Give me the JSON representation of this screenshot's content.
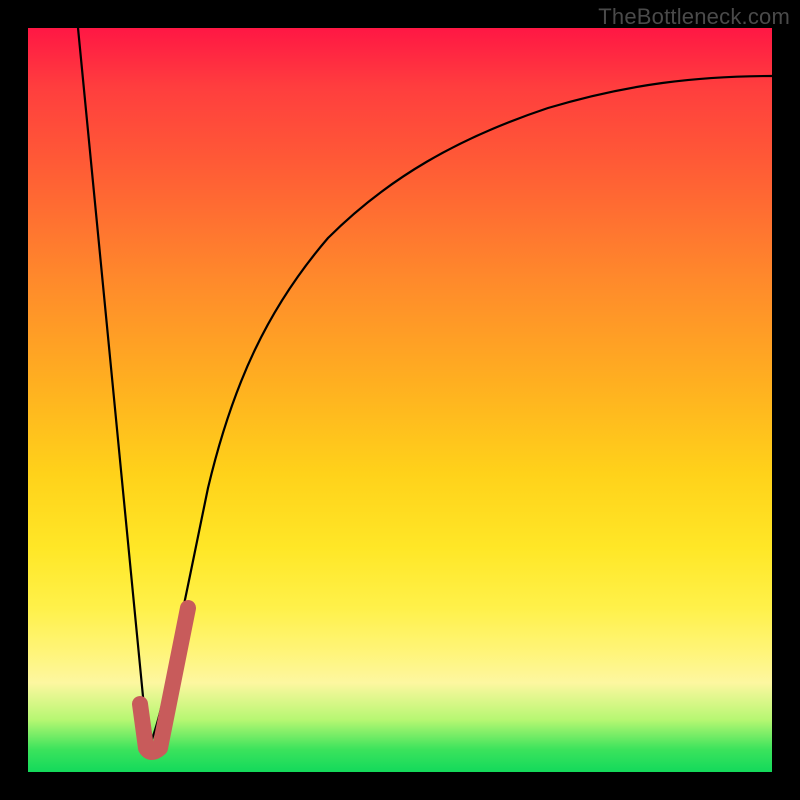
{
  "watermark": "TheBottleneck.com",
  "colors": {
    "frame": "#000000",
    "curve": "#000000",
    "accent_marker": "#c85b5b"
  },
  "chart_data": {
    "type": "line",
    "title": "",
    "xlabel": "",
    "ylabel": "",
    "xlim": [
      0,
      100
    ],
    "ylim": [
      0,
      100
    ],
    "grid": false,
    "series": [
      {
        "name": "left-slope",
        "x": [
          5,
          16
        ],
        "y": [
          100,
          3
        ]
      },
      {
        "name": "right-curve",
        "x": [
          16,
          20,
          25,
          30,
          35,
          40,
          45,
          50,
          55,
          60,
          70,
          80,
          90,
          100
        ],
        "y": [
          3,
          22,
          40,
          52,
          60,
          67,
          72,
          76,
          79,
          82,
          86,
          89,
          91,
          92
        ]
      }
    ],
    "accent_marker": {
      "name": "selection-J",
      "x": [
        16,
        16.2,
        20
      ],
      "y": [
        7,
        3,
        22
      ]
    }
  }
}
